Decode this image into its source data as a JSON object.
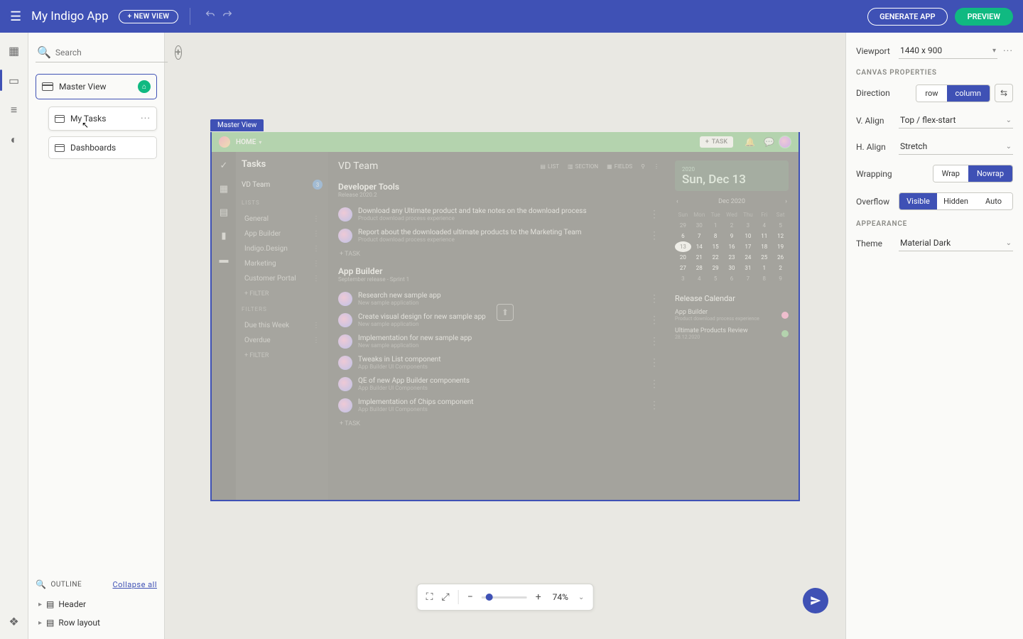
{
  "topbar": {
    "title": "My Indigo App",
    "new_view": "+ NEW VIEW",
    "generate": "GENERATE APP",
    "preview": "PREVIEW"
  },
  "views": {
    "search_placeholder": "Search",
    "master": "Master View",
    "subviews": [
      "My Tasks",
      "Dashboards"
    ]
  },
  "outline": {
    "label": "OUTLINE",
    "collapse": "Collapse all",
    "items": [
      "Header",
      "Row layout"
    ]
  },
  "canvas": {
    "label": "Master View",
    "header": {
      "home": "HOME",
      "task_btn": "TASK"
    },
    "side": {
      "title": "Tasks",
      "team": "VD Team",
      "team_count": "3",
      "lists_label": "LISTS",
      "lists": [
        "General",
        "App Builder",
        "Indigo.Design",
        "Marketing",
        "Customer Portal"
      ],
      "filter": "FILTER",
      "filters_label": "FILTERS",
      "filters": [
        "Due this Week",
        "Overdue"
      ]
    },
    "main": {
      "title": "VD Team",
      "toolbar": {
        "list": "LIST",
        "section": "SECTION",
        "fields": "FIELDS"
      },
      "groups": [
        {
          "title": "Developer Tools",
          "subtitle": "Release 2020.2",
          "tasks": [
            {
              "t": "Download any Ultimate product and take notes on the download process",
              "s": "Product download process experience"
            },
            {
              "t": "Report about the downloaded ultimate products to the Marketing Team",
              "s": "Product download process experience"
            }
          ]
        },
        {
          "title": "App Builder",
          "subtitle": "September release - Sprint 1",
          "tasks": [
            {
              "t": "Research new sample app",
              "s": "New sample application"
            },
            {
              "t": "Create visual design for new sample app",
              "s": "New sample application"
            },
            {
              "t": "Implementation for new sample app",
              "s": "New sample application"
            },
            {
              "t": "Tweaks in List component",
              "s": "App Builder UI Components"
            },
            {
              "t": "QE of new App Builder components",
              "s": "App Builder UI Components"
            },
            {
              "t": "Implementation of Chips component",
              "s": "App Builder UI Components"
            }
          ]
        }
      ],
      "add_task": "TASK",
      "date": {
        "year": "2020",
        "full": "Sun, Dec 13"
      },
      "calendar": {
        "month": "Dec 2020",
        "dow": [
          "Sun",
          "Mon",
          "Tue",
          "Wed",
          "Thu",
          "Fri",
          "Sat"
        ],
        "rows": [
          [
            "29",
            "30",
            "1",
            "2",
            "3",
            "4",
            "5"
          ],
          [
            "6",
            "7",
            "8",
            "9",
            "10",
            "11",
            "12"
          ],
          [
            "13",
            "14",
            "15",
            "16",
            "17",
            "18",
            "19"
          ],
          [
            "20",
            "21",
            "22",
            "23",
            "24",
            "25",
            "26"
          ],
          [
            "27",
            "28",
            "29",
            "30",
            "31",
            "1",
            "2"
          ],
          [
            "3",
            "4",
            "5",
            "6",
            "7",
            "8",
            "9"
          ]
        ],
        "today": "13"
      },
      "release": {
        "title": "Release Calendar",
        "items": [
          {
            "t": "App Builder",
            "s": "Product download process experience",
            "c": "#ff6fae"
          },
          {
            "t": "Ultimate Products Review",
            "s": "28.12.2020",
            "c": "#4caf50"
          }
        ]
      }
    }
  },
  "zoom": {
    "value": "74%"
  },
  "props": {
    "viewport_label": "Viewport",
    "viewport_value": "1440 x 900",
    "canvas_section": "CANVAS PROPERTIES",
    "direction": {
      "label": "Direction",
      "row": "row",
      "column": "column"
    },
    "valign": {
      "label": "V. Align",
      "value": "Top / flex-start"
    },
    "halign": {
      "label": "H. Align",
      "value": "Stretch"
    },
    "wrapping": {
      "label": "Wrapping",
      "wrap": "Wrap",
      "nowrap": "Nowrap"
    },
    "overflow": {
      "label": "Overflow",
      "visible": "Visible",
      "hidden": "Hidden",
      "auto": "Auto"
    },
    "appearance_section": "APPEARANCE",
    "theme": {
      "label": "Theme",
      "value": "Material Dark"
    }
  }
}
